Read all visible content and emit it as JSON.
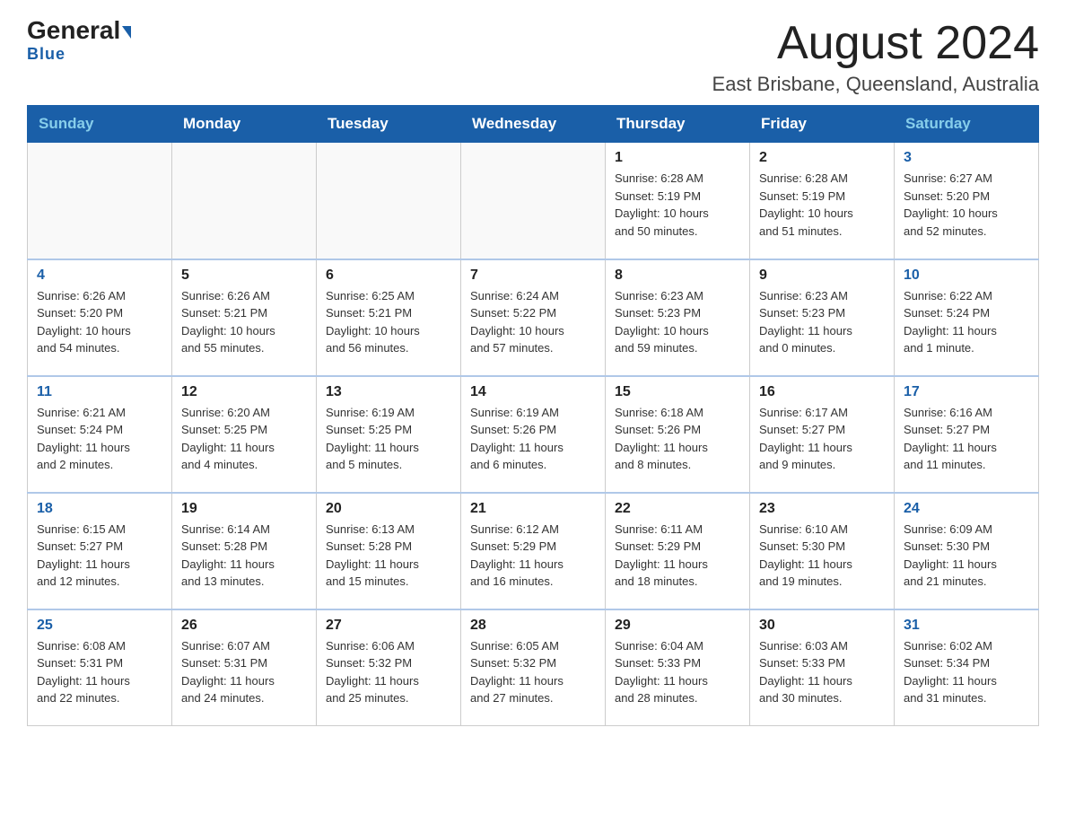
{
  "header": {
    "logo_general": "General",
    "logo_blue": "Blue",
    "title": "August 2024",
    "subtitle": "East Brisbane, Queensland, Australia"
  },
  "days_of_week": [
    "Sunday",
    "Monday",
    "Tuesday",
    "Wednesday",
    "Thursday",
    "Friday",
    "Saturday"
  ],
  "weeks": [
    [
      {
        "day": "",
        "info": ""
      },
      {
        "day": "",
        "info": ""
      },
      {
        "day": "",
        "info": ""
      },
      {
        "day": "",
        "info": ""
      },
      {
        "day": "1",
        "info": "Sunrise: 6:28 AM\nSunset: 5:19 PM\nDaylight: 10 hours\nand 50 minutes."
      },
      {
        "day": "2",
        "info": "Sunrise: 6:28 AM\nSunset: 5:19 PM\nDaylight: 10 hours\nand 51 minutes."
      },
      {
        "day": "3",
        "info": "Sunrise: 6:27 AM\nSunset: 5:20 PM\nDaylight: 10 hours\nand 52 minutes."
      }
    ],
    [
      {
        "day": "4",
        "info": "Sunrise: 6:26 AM\nSunset: 5:20 PM\nDaylight: 10 hours\nand 54 minutes."
      },
      {
        "day": "5",
        "info": "Sunrise: 6:26 AM\nSunset: 5:21 PM\nDaylight: 10 hours\nand 55 minutes."
      },
      {
        "day": "6",
        "info": "Sunrise: 6:25 AM\nSunset: 5:21 PM\nDaylight: 10 hours\nand 56 minutes."
      },
      {
        "day": "7",
        "info": "Sunrise: 6:24 AM\nSunset: 5:22 PM\nDaylight: 10 hours\nand 57 minutes."
      },
      {
        "day": "8",
        "info": "Sunrise: 6:23 AM\nSunset: 5:23 PM\nDaylight: 10 hours\nand 59 minutes."
      },
      {
        "day": "9",
        "info": "Sunrise: 6:23 AM\nSunset: 5:23 PM\nDaylight: 11 hours\nand 0 minutes."
      },
      {
        "day": "10",
        "info": "Sunrise: 6:22 AM\nSunset: 5:24 PM\nDaylight: 11 hours\nand 1 minute."
      }
    ],
    [
      {
        "day": "11",
        "info": "Sunrise: 6:21 AM\nSunset: 5:24 PM\nDaylight: 11 hours\nand 2 minutes."
      },
      {
        "day": "12",
        "info": "Sunrise: 6:20 AM\nSunset: 5:25 PM\nDaylight: 11 hours\nand 4 minutes."
      },
      {
        "day": "13",
        "info": "Sunrise: 6:19 AM\nSunset: 5:25 PM\nDaylight: 11 hours\nand 5 minutes."
      },
      {
        "day": "14",
        "info": "Sunrise: 6:19 AM\nSunset: 5:26 PM\nDaylight: 11 hours\nand 6 minutes."
      },
      {
        "day": "15",
        "info": "Sunrise: 6:18 AM\nSunset: 5:26 PM\nDaylight: 11 hours\nand 8 minutes."
      },
      {
        "day": "16",
        "info": "Sunrise: 6:17 AM\nSunset: 5:27 PM\nDaylight: 11 hours\nand 9 minutes."
      },
      {
        "day": "17",
        "info": "Sunrise: 6:16 AM\nSunset: 5:27 PM\nDaylight: 11 hours\nand 11 minutes."
      }
    ],
    [
      {
        "day": "18",
        "info": "Sunrise: 6:15 AM\nSunset: 5:27 PM\nDaylight: 11 hours\nand 12 minutes."
      },
      {
        "day": "19",
        "info": "Sunrise: 6:14 AM\nSunset: 5:28 PM\nDaylight: 11 hours\nand 13 minutes."
      },
      {
        "day": "20",
        "info": "Sunrise: 6:13 AM\nSunset: 5:28 PM\nDaylight: 11 hours\nand 15 minutes."
      },
      {
        "day": "21",
        "info": "Sunrise: 6:12 AM\nSunset: 5:29 PM\nDaylight: 11 hours\nand 16 minutes."
      },
      {
        "day": "22",
        "info": "Sunrise: 6:11 AM\nSunset: 5:29 PM\nDaylight: 11 hours\nand 18 minutes."
      },
      {
        "day": "23",
        "info": "Sunrise: 6:10 AM\nSunset: 5:30 PM\nDaylight: 11 hours\nand 19 minutes."
      },
      {
        "day": "24",
        "info": "Sunrise: 6:09 AM\nSunset: 5:30 PM\nDaylight: 11 hours\nand 21 minutes."
      }
    ],
    [
      {
        "day": "25",
        "info": "Sunrise: 6:08 AM\nSunset: 5:31 PM\nDaylight: 11 hours\nand 22 minutes."
      },
      {
        "day": "26",
        "info": "Sunrise: 6:07 AM\nSunset: 5:31 PM\nDaylight: 11 hours\nand 24 minutes."
      },
      {
        "day": "27",
        "info": "Sunrise: 6:06 AM\nSunset: 5:32 PM\nDaylight: 11 hours\nand 25 minutes."
      },
      {
        "day": "28",
        "info": "Sunrise: 6:05 AM\nSunset: 5:32 PM\nDaylight: 11 hours\nand 27 minutes."
      },
      {
        "day": "29",
        "info": "Sunrise: 6:04 AM\nSunset: 5:33 PM\nDaylight: 11 hours\nand 28 minutes."
      },
      {
        "day": "30",
        "info": "Sunrise: 6:03 AM\nSunset: 5:33 PM\nDaylight: 11 hours\nand 30 minutes."
      },
      {
        "day": "31",
        "info": "Sunrise: 6:02 AM\nSunset: 5:34 PM\nDaylight: 11 hours\nand 31 minutes."
      }
    ]
  ]
}
